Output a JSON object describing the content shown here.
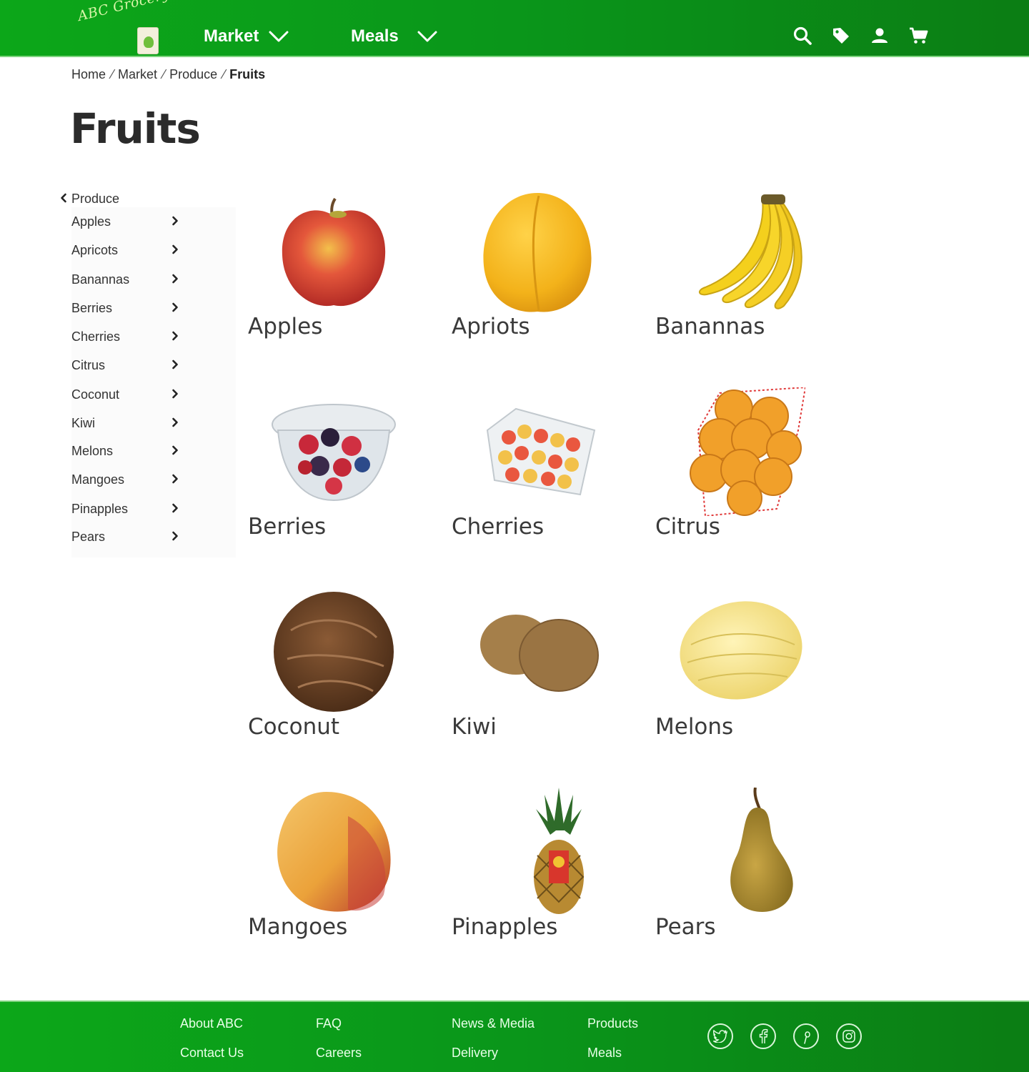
{
  "brand": {
    "logo_text": "ABC Grocery"
  },
  "nav": {
    "items": [
      {
        "label": "Market"
      },
      {
        "label": "Meals"
      }
    ]
  },
  "header_icons": [
    "search-icon",
    "tag-icon",
    "user-icon",
    "cart-icon"
  ],
  "breadcrumb": {
    "items": [
      "Home",
      "Market",
      "Produce"
    ],
    "current": "Fruits"
  },
  "page": {
    "title": "Fruits"
  },
  "sidebar": {
    "parent_label": "Produce",
    "items": [
      "Apples",
      "Apricots",
      "Banannas",
      "Berries",
      "Cherries",
      "Citrus",
      "Coconut",
      "Kiwi",
      "Melons",
      "Mangoes",
      "Pinapples",
      "Pears"
    ]
  },
  "products": [
    {
      "label": "Apples"
    },
    {
      "label": "Apriots"
    },
    {
      "label": "Banannas"
    },
    {
      "label": "Berries"
    },
    {
      "label": "Cherries"
    },
    {
      "label": "Citrus"
    },
    {
      "label": "Coconut"
    },
    {
      "label": "Kiwi"
    },
    {
      "label": "Melons"
    },
    {
      "label": "Mangoes"
    },
    {
      "label": "Pinapples"
    },
    {
      "label": "Pears"
    }
  ],
  "footer": {
    "links": [
      "About ABC",
      "Contact Us",
      "FAQ",
      "Careers",
      "News & Media",
      "Delivery",
      "Products",
      "Meals"
    ],
    "social": [
      "twitter-icon",
      "facebook-icon",
      "pinterest-icon",
      "instagram-icon"
    ]
  },
  "colors": {
    "brand_green": "#0a961a",
    "text_dark": "#333333"
  }
}
